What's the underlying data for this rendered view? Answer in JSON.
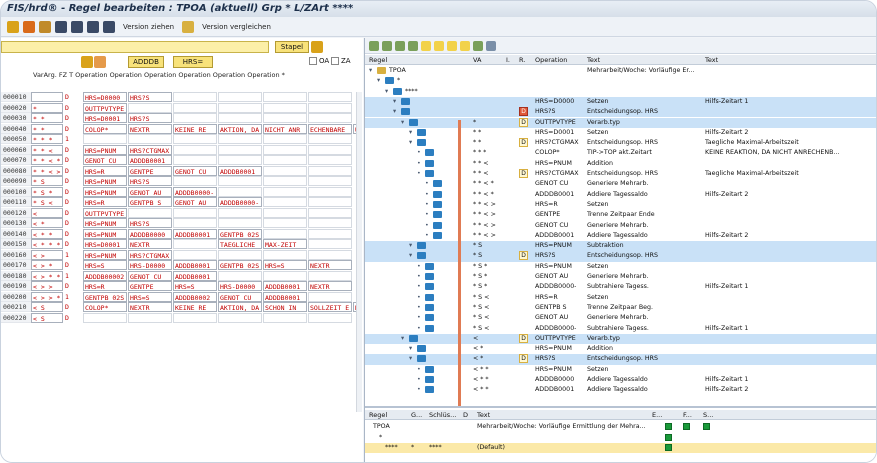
{
  "window": {
    "title": "FIS/hrd® - Regel bearbeiten : TPOA (aktuell)  Grp * L/ZArt ****"
  },
  "toolbar": {
    "version_pull": "Version ziehen",
    "version_compare": "Version vergleichen"
  },
  "left": {
    "stapel": "Stapel",
    "btn_addb": "ADDDB",
    "btn_hrs": "HRS=",
    "oa": "OA",
    "za": "ZA",
    "header": "VarArg. FZ T Operation  Operation  Operation  Operation  Operation  Operation  * ",
    "rows": [
      {
        "num": "000010",
        "var": "",
        "d": "D",
        "c": [
          "HRS=D0000",
          "HRS?S",
          "",
          "",
          "",
          ""
        ]
      },
      {
        "num": "000020",
        "var": "*",
        "d": "D",
        "c": [
          "OUTTPVTYPE",
          "",
          "",
          "",
          "",
          ""
        ]
      },
      {
        "num": "000030",
        "var": "* *",
        "d": "D",
        "c": [
          "HRS=D0001",
          "HRS?S",
          "",
          "",
          "",
          ""
        ]
      },
      {
        "num": "000040",
        "var": "* *",
        "d": "D",
        "c": [
          "COLOP*",
          "NEXTR",
          "KEINE RE",
          "AKTION, DA",
          "NICHT ANR",
          "ECHENBARE",
          "U"
        ]
      },
      {
        "num": "000050",
        "var": "* * *",
        "d": "1",
        "c": [
          "",
          "",
          "",
          "",
          "",
          ""
        ]
      },
      {
        "num": "000060",
        "var": "* * <",
        "d": "D",
        "c": [
          "HRS=PNUM",
          "HRS?CTGMAX",
          "",
          "",
          "",
          ""
        ]
      },
      {
        "num": "000070",
        "var": "* * < *",
        "d": "D",
        "c": [
          "GENOT CU",
          "ADDDB0001",
          "",
          "",
          "",
          ""
        ]
      },
      {
        "num": "000080",
        "var": "* * < >",
        "d": "D",
        "c": [
          "HRS=R",
          "GENTPE",
          "GENOT CU",
          "ADDDB0001",
          "",
          ""
        ]
      },
      {
        "num": "000090",
        "var": "* S",
        "d": "D",
        "c": [
          "HRS=PNUM",
          "HRS?S",
          "",
          "",
          "",
          ""
        ]
      },
      {
        "num": "000100",
        "var": "* S *",
        "d": "D",
        "c": [
          "HRS=PNUM",
          "GENOT AU",
          "ADDDB0000-",
          "",
          "",
          ""
        ]
      },
      {
        "num": "000110",
        "var": "* S <",
        "d": "D",
        "c": [
          "HRS=R",
          "GENTPB  S",
          "GENOT AU",
          "ADDDB0000-",
          "",
          ""
        ]
      },
      {
        "num": "000120",
        "var": "<",
        "d": "D",
        "c": [
          "OUTTPVTYPE",
          "",
          "",
          "",
          "",
          ""
        ]
      },
      {
        "num": "000130",
        "var": "< *",
        "d": "D",
        "c": [
          "HRS=PNUM",
          "HRS?S",
          "",
          "",
          "",
          ""
        ]
      },
      {
        "num": "000140",
        "var": "< * *",
        "d": "D",
        "c": [
          "HRS=PNUM",
          "ADDDB0000",
          "ADDDB0001",
          "GENTPB 02S",
          "",
          ""
        ]
      },
      {
        "num": "000150",
        "var": "< * * *",
        "d": "D",
        "c": [
          "HRS=D0001",
          "NEXTR",
          "",
          "TAEGLICHE",
          "MAX-ZEIT",
          ""
        ]
      },
      {
        "num": "000160",
        "var": "< >",
        "d": "1",
        "c": [
          "HRS=PNUM",
          "HRS?CTGMAX",
          "",
          "",
          "",
          ""
        ]
      },
      {
        "num": "000170",
        "var": "< > *",
        "d": "D",
        "c": [
          "HRS=S",
          "HRS-D0000",
          "ADDDB0001",
          "GENTPB 02S",
          "HRS=S",
          "NEXTR"
        ]
      },
      {
        "num": "000180",
        "var": "< > * *",
        "d": "1",
        "c": [
          "ADDDB00002",
          "GENOT CU",
          "ADDDB0001",
          "",
          "",
          ""
        ]
      },
      {
        "num": "000190",
        "var": "< > >",
        "d": "D",
        "c": [
          "HRS=R",
          "GENTPE",
          "HRS=S",
          "HRS-D0000",
          "ADDDB0001",
          "NEXTR"
        ]
      },
      {
        "num": "000200",
        "var": "< > > *",
        "d": "1",
        "c": [
          "GENTPB 02S",
          "HRS=S",
          "ADDDB0002",
          "GENOT CU",
          "ADDDB0001",
          ""
        ]
      },
      {
        "num": "000210",
        "var": "< S",
        "d": "D",
        "c": [
          "COLOP*",
          "NEXTR",
          "KEINE RE",
          "AKTION, DA",
          "SCHON IN",
          "SOLLZEIT E",
          "N"
        ]
      },
      {
        "num": "000220",
        "var": "< S",
        "d": "D",
        "c": [
          "",
          "",
          "",
          "",
          "",
          ""
        ]
      }
    ]
  },
  "right": {
    "headers": {
      "regel": "Regel",
      "va": "VA",
      "i": "I.",
      "r": "R.",
      "operation": "Operation",
      "text": "Text",
      "text2": "Text"
    },
    "rows": [
      {
        "regel": "TPOA",
        "va": "",
        "ir": "",
        "op": "",
        "text": "Mehrarbeit/Woche: Vorläufige Er...",
        "text2": "",
        "lvl": 0,
        "hl": false
      },
      {
        "regel": "*",
        "va": "",
        "ir": "",
        "op": "",
        "text": "",
        "text2": "",
        "lvl": 1,
        "hl": false
      },
      {
        "regel": "****",
        "va": "",
        "ir": "",
        "op": "",
        "text": "",
        "text2": "",
        "lvl": 2,
        "hl": false
      },
      {
        "regel": "",
        "va": "",
        "ir": "",
        "op": "HRS=D0000",
        "text": "Setzen",
        "text2": "Hilfs-Zeitart 1",
        "lvl": 3,
        "hl": true
      },
      {
        "regel": "",
        "va": "",
        "ir": "D",
        "op": "HRS?S",
        "text": "Entscheidungsop. HRS",
        "text2": "",
        "lvl": 3,
        "hl": true
      },
      {
        "regel": "",
        "va": "*",
        "ir": "D",
        "op": "OUTTPVTYPE",
        "text": "Verarb.typ",
        "text2": "",
        "lvl": 4,
        "hl": true
      },
      {
        "regel": "",
        "va": "* *",
        "ir": "",
        "op": "HRS=D0001",
        "text": "Setzen",
        "text2": "Hilfs-Zeitart 2",
        "lvl": 5,
        "hl": false
      },
      {
        "regel": "",
        "va": "* *",
        "ir": "D",
        "op": "HRS?CTGMAX",
        "text": "Entscheidungsop. HRS",
        "text2": "Taegliche Maximal-Arbeitszeit",
        "lvl": 5,
        "hl": false
      },
      {
        "regel": "",
        "va": "* * *",
        "ir": "",
        "op": "COLOP*",
        "text": "TIP->TOP akt.Zeitart",
        "text2": "KEINE REAKTION, DA NICHT ANRECHENB...",
        "lvl": 6,
        "hl": false
      },
      {
        "regel": "",
        "va": "* * <",
        "ir": "",
        "op": "HRS=PNUM",
        "text": "Addition",
        "text2": "",
        "lvl": 6,
        "hl": false
      },
      {
        "regel": "",
        "va": "* * <",
        "ir": "D",
        "op": "HRS?CTGMAX",
        "text": "Entscheidungsop. HRS",
        "text2": "Taegliche Maximal-Arbeitszeit",
        "lvl": 6,
        "hl": false
      },
      {
        "regel": "",
        "va": "* * < *",
        "ir": "",
        "op": "GENOT CU",
        "text": "Generiere Mehrarb.",
        "text2": "",
        "lvl": 7,
        "hl": false
      },
      {
        "regel": "",
        "va": "* * < *",
        "ir": "",
        "op": "ADDDB0001",
        "text": "Addiere Tagessaldo",
        "text2": "Hilfs-Zeitart 2",
        "lvl": 7,
        "hl": false
      },
      {
        "regel": "",
        "va": "* * < >",
        "ir": "",
        "op": "HRS=R",
        "text": "Setzen",
        "text2": "",
        "lvl": 7,
        "hl": false
      },
      {
        "regel": "",
        "va": "* * < >",
        "ir": "",
        "op": "GENTPE",
        "text": "Trenne Zeitpaar Ende",
        "text2": "",
        "lvl": 7,
        "hl": false
      },
      {
        "regel": "",
        "va": "* * < >",
        "ir": "",
        "op": "GENOT CU",
        "text": "Generiere Mehrarb.",
        "text2": "",
        "lvl": 7,
        "hl": false
      },
      {
        "regel": "",
        "va": "* * < >",
        "ir": "",
        "op": "ADDDB0001",
        "text": "Addiere Tagessaldo",
        "text2": "Hilfs-Zeitart 2",
        "lvl": 7,
        "hl": false
      },
      {
        "regel": "",
        "va": "* S",
        "ir": "",
        "op": "HRS=PNUM",
        "text": "Subtraktion",
        "text2": "",
        "lvl": 5,
        "hl": true
      },
      {
        "regel": "",
        "va": "* S",
        "ir": "D",
        "op": "HRS?S",
        "text": "Entscheidungsop. HRS",
        "text2": "",
        "lvl": 5,
        "hl": true
      },
      {
        "regel": "",
        "va": "* S *",
        "ir": "",
        "op": "HRS=PNUM",
        "text": "Setzen",
        "text2": "",
        "lvl": 6,
        "hl": false
      },
      {
        "regel": "",
        "va": "* S *",
        "ir": "",
        "op": "GENOT AU",
        "text": "Generiere Mehrarb.",
        "text2": "",
        "lvl": 6,
        "hl": false
      },
      {
        "regel": "",
        "va": "* S *",
        "ir": "",
        "op": "ADDDB0000-",
        "text": "Subtrahiere Tagess.",
        "text2": "Hilfs-Zeitart 1",
        "lvl": 6,
        "hl": false
      },
      {
        "regel": "",
        "va": "* S <",
        "ir": "",
        "op": "HRS=R",
        "text": "Setzen",
        "text2": "",
        "lvl": 6,
        "hl": false
      },
      {
        "regel": "",
        "va": "* S <",
        "ir": "",
        "op": "GENTPB   S",
        "text": "Trenne Zeitpaar Beg.",
        "text2": "",
        "lvl": 6,
        "hl": false
      },
      {
        "regel": "",
        "va": "* S <",
        "ir": "",
        "op": "GENOT AU",
        "text": "Generiere Mehrarb.",
        "text2": "",
        "lvl": 6,
        "hl": false
      },
      {
        "regel": "",
        "va": "* S <",
        "ir": "",
        "op": "ADDDB0000-",
        "text": "Subtrahiere Tagess.",
        "text2": "Hilfs-Zeitart 1",
        "lvl": 6,
        "hl": false
      },
      {
        "regel": "",
        "va": "<",
        "ir": "D",
        "op": "OUTTPVTYPE",
        "text": "Verarb.typ",
        "text2": "",
        "lvl": 4,
        "hl": true
      },
      {
        "regel": "",
        "va": "< *",
        "ir": "",
        "op": "HRS=PNUM",
        "text": "Addition",
        "text2": "",
        "lvl": 5,
        "hl": false
      },
      {
        "regel": "",
        "va": "< *",
        "ir": "D",
        "op": "HRS?S",
        "text": "Entscheidungsop. HRS",
        "text2": "",
        "lvl": 5,
        "hl": true
      },
      {
        "regel": "",
        "va": "< * *",
        "ir": "",
        "op": "HRS=PNUM",
        "text": "Setzen",
        "text2": "",
        "lvl": 6,
        "hl": false
      },
      {
        "regel": "",
        "va": "< * *",
        "ir": "",
        "op": "ADDDB0000",
        "text": "Addiere Tagessaldo",
        "text2": "Hilfs-Zeitart 1",
        "lvl": 6,
        "hl": false
      },
      {
        "regel": "",
        "va": "< * *",
        "ir": "",
        "op": "ADDDB0001",
        "text": "Addiere Tagessaldo",
        "text2": "Hilfs-Zeitart 2",
        "lvl": 6,
        "hl": false
      }
    ],
    "lower": {
      "headers": {
        "regel": "Regel",
        "g": "G...",
        "schl": "Schlüs...",
        "d": "D",
        "text": "Text",
        "e": "E...",
        "f": "F...",
        "s": "S..."
      },
      "rows": [
        {
          "regel": "TPOA",
          "g": "",
          "schl": "",
          "text": "Mehrarbeit/Woche: Vorläufige Ermittlung der Mehra..."
        },
        {
          "regel": "*",
          "g": "",
          "schl": "",
          "text": ""
        },
        {
          "regel": "****",
          "g": "*",
          "schl": "****",
          "text": "(Default)"
        }
      ]
    }
  },
  "colors": {
    "accent": "#2c7ec0",
    "highlight": "#c9e1f7",
    "yellow": "#f8e27a",
    "red": "#c00000",
    "orange": "#e07b53",
    "green": "#1a9a3a"
  }
}
